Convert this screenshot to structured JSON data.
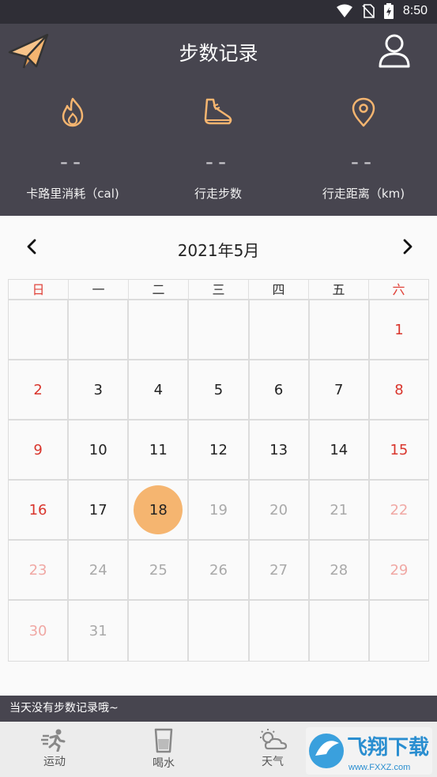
{
  "status_bar": {
    "time": "8:50"
  },
  "header": {
    "title": "步数记录"
  },
  "stats": [
    {
      "value": "--",
      "label": "卡路里消耗（cal)"
    },
    {
      "value": "--",
      "label": "行走步数"
    },
    {
      "value": "--",
      "label": "行走距离（km)"
    }
  ],
  "calendar": {
    "month_label": "2021年5月",
    "weekdays": [
      "日",
      "一",
      "二",
      "三",
      "四",
      "五",
      "六"
    ],
    "weeks": [
      [
        "",
        "",
        "",
        "",
        "",
        "",
        "1"
      ],
      [
        "2",
        "3",
        "4",
        "5",
        "6",
        "7",
        "8"
      ],
      [
        "9",
        "10",
        "11",
        "12",
        "13",
        "14",
        "15"
      ],
      [
        "16",
        "17",
        "18",
        "19",
        "20",
        "21",
        "22"
      ],
      [
        "23",
        "24",
        "25",
        "26",
        "27",
        "28",
        "29"
      ],
      [
        "30",
        "31",
        "",
        "",
        "",
        "",
        ""
      ]
    ],
    "selected_day": "18"
  },
  "message": "当天没有步数记录哦~",
  "tabs": [
    {
      "label": "运动",
      "icon": "run-icon"
    },
    {
      "label": "喝水",
      "icon": "water-cup-icon"
    },
    {
      "label": "天气",
      "icon": "weather-icon"
    }
  ],
  "watermark": {
    "text": "飞翔下载",
    "url_text": "www.FXXZ.com"
  },
  "colors": {
    "header_bg": "#47454f",
    "accent": "#f5b570",
    "weekend_red": "#d9352c"
  }
}
